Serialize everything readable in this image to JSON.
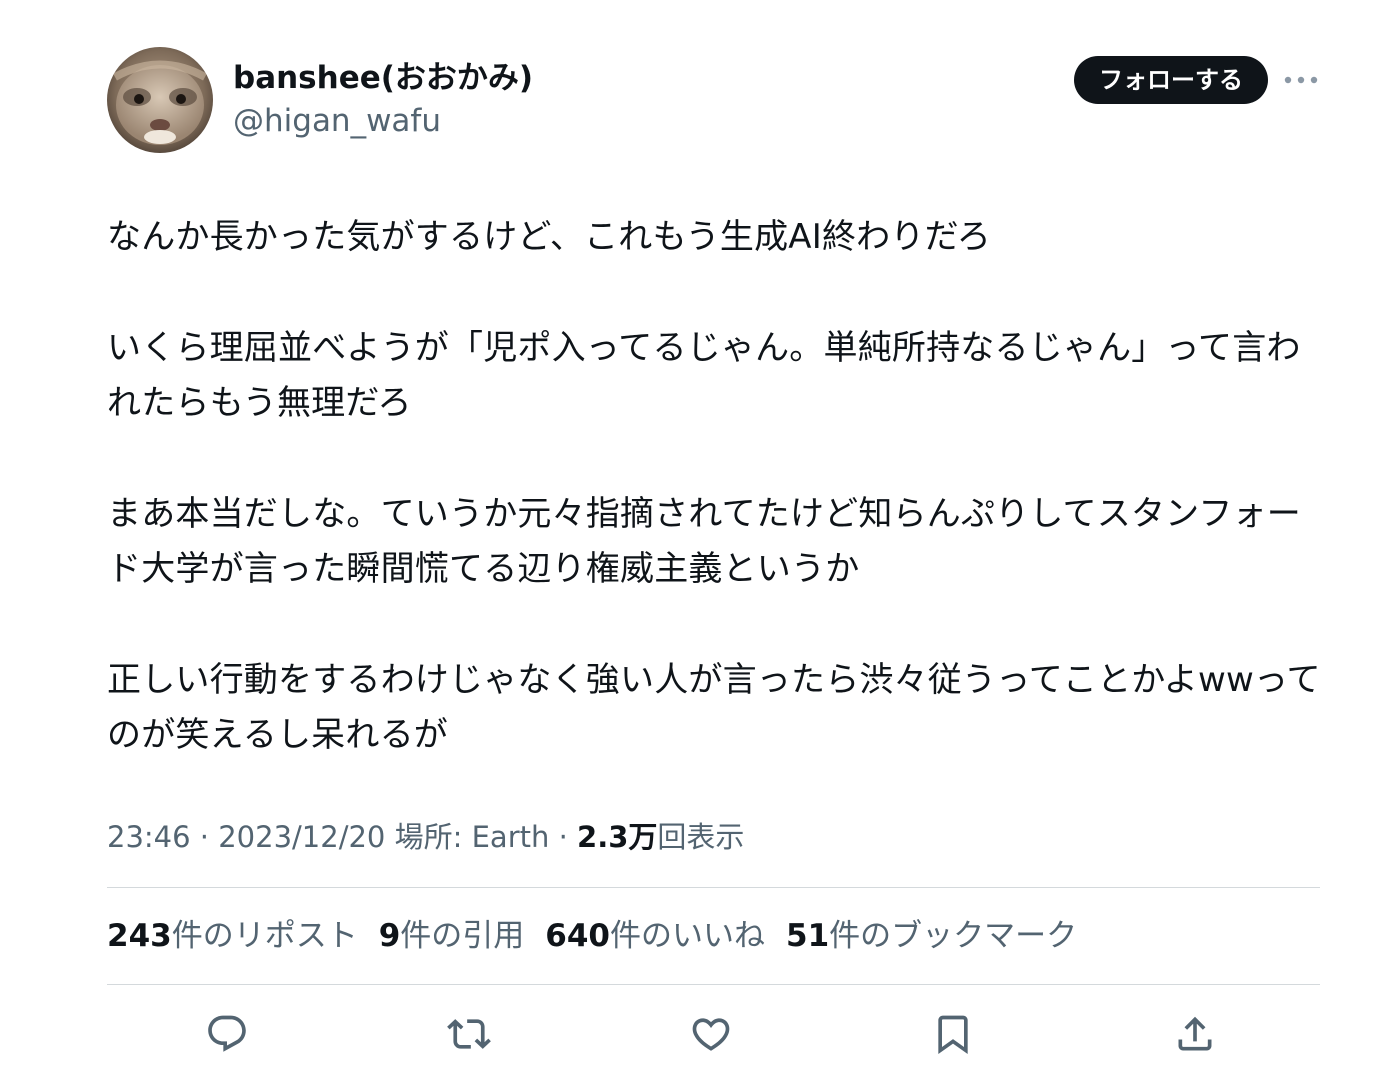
{
  "author": {
    "display_name": "banshee(おおかみ)",
    "handle": "@higan_wafu",
    "avatar_icon": "ferret-avatar"
  },
  "follow_label": "フォローする",
  "more_icon": "more-dots-icon",
  "tweet": {
    "paragraphs": [
      "なんか長かった気がするけど、これもう生成AI終わりだろ",
      "いくら理屈並べようが「児ポ入ってるじゃん。単純所持なるじゃん」って言われたらもう無理だろ",
      "まあ本当だしな。ていうか元々指摘されてたけど知らんぷりしてスタンフォード大学が言った瞬間慌てる辺り権威主義というか",
      "正しい行動をするわけじゃなく強い人が言ったら渋々従うってことかよwwってのが笑えるし呆れるが"
    ]
  },
  "meta": {
    "time": "23:46",
    "sep1": " · ",
    "date": "2023/12/20",
    "location": " 場所: Earth",
    "sep2": " · ",
    "views_count": "2.3万",
    "views_label": "回表示"
  },
  "stats": {
    "reposts": {
      "count": "243",
      "label": "件のリポスト"
    },
    "quotes": {
      "count": "9",
      "label": "件の引用"
    },
    "likes": {
      "count": "640",
      "label": "件のいいね"
    },
    "bookmarks": {
      "count": "51",
      "label": "件のブックマーク"
    }
  },
  "actions": [
    "reply-icon",
    "repost-icon",
    "like-icon",
    "bookmark-icon",
    "share-icon"
  ],
  "colors": {
    "text": "#0f1419",
    "secondary": "#536471",
    "divider": "#d4d9dc",
    "follow_bg": "#0f1419"
  }
}
